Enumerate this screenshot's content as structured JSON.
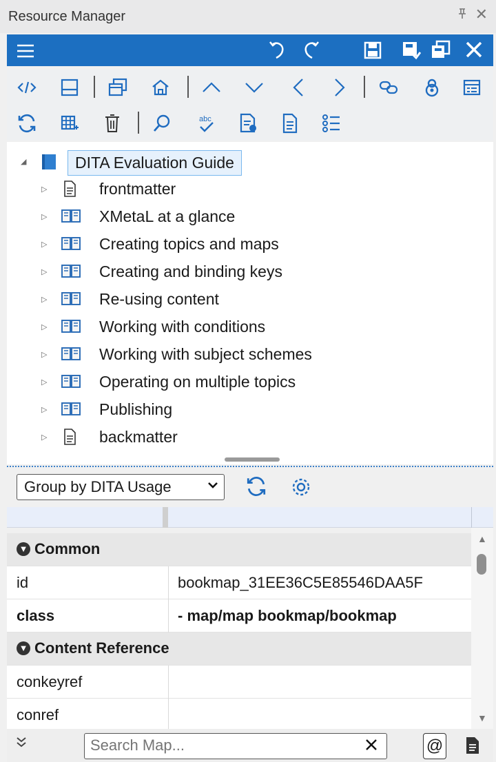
{
  "window": {
    "title": "Resource Manager",
    "pin_glyph": "ᵖ",
    "close_glyph": "✕"
  },
  "tree": {
    "root": "DITA Evaluation Guide",
    "children": [
      {
        "label": "frontmatter",
        "icon": "document-icon"
      },
      {
        "label": "XMetaL at a glance",
        "icon": "book-icon"
      },
      {
        "label": "Creating topics and maps",
        "icon": "book-icon"
      },
      {
        "label": "Creating and binding keys",
        "icon": "book-icon"
      },
      {
        "label": "Re-using content",
        "icon": "book-icon"
      },
      {
        "label": "Working with conditions",
        "icon": "book-icon"
      },
      {
        "label": "Working with subject schemes",
        "icon": "book-icon"
      },
      {
        "label": "Operating on multiple topics",
        "icon": "book-icon"
      },
      {
        "label": "Publishing",
        "icon": "book-icon"
      },
      {
        "label": "backmatter",
        "icon": "document-icon"
      }
    ]
  },
  "group": {
    "selected": "Group by DITA Usage"
  },
  "properties": {
    "sections": {
      "common": "Common",
      "content_reference": "Content Reference"
    },
    "rows": {
      "id_key": "id",
      "id_value": "bookmap_31EE36C5E85546DAA5F",
      "class_key": "class",
      "class_value": "- map/map bookmap/bookmap",
      "conkeyref_key": "conkeyref",
      "conkeyref_value": "",
      "conref_key": "conref",
      "conref_value": ""
    }
  },
  "search": {
    "placeholder": "Search Map..."
  },
  "colors": {
    "accent": "#1c6fc1",
    "toolbar_icon": "#1f6cc0"
  }
}
